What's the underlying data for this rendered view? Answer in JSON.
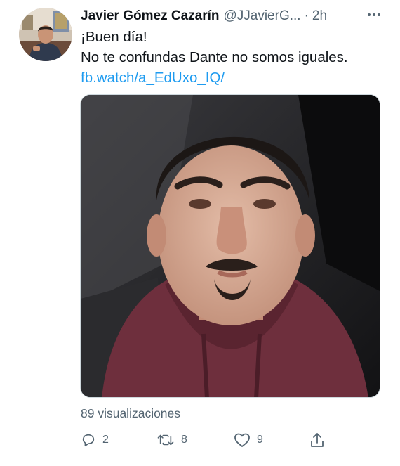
{
  "tweet": {
    "author_name": "Javier Gómez Cazarín",
    "handle": "@JJavierG...",
    "separator": "·",
    "time": "2h",
    "text_lines": [
      "¡Buen día!",
      "No te confundas Dante no somos iguales."
    ],
    "link": "fb.watch/a_EdUxo_IQ/",
    "views": "89 visualizaciones",
    "actions": {
      "replies": "2",
      "retweets": "8",
      "likes": "9"
    }
  },
  "colors": {
    "text": "#0f1419",
    "secondary": "#536471",
    "link": "#1d9bf0",
    "border": "#cfd9de"
  },
  "icons": [
    "more-icon",
    "reply-icon",
    "retweet-icon",
    "like-icon",
    "share-icon"
  ]
}
